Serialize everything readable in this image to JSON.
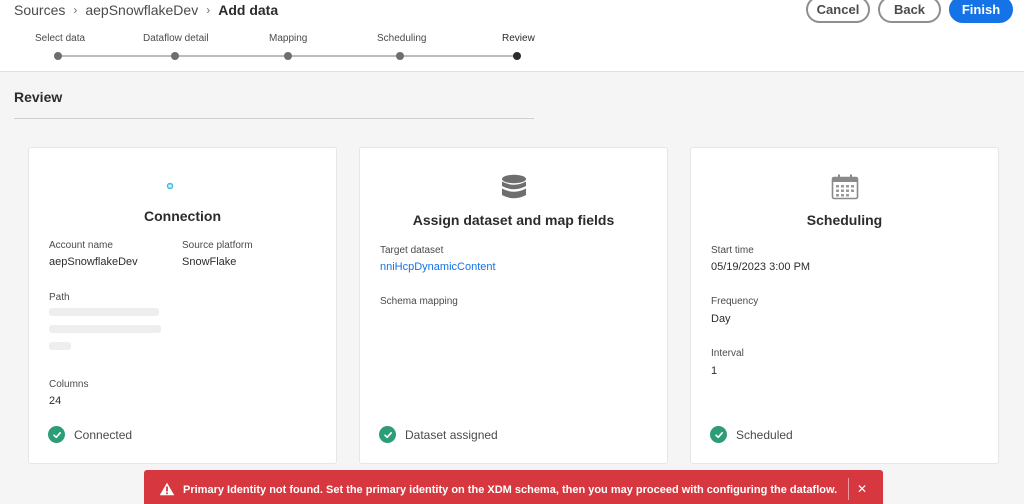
{
  "breadcrumb": {
    "items": [
      "Sources",
      "aepSnowflakeDev"
    ],
    "current": "Add data"
  },
  "actions": {
    "cancel_label": "Cancel",
    "back_label": "Back",
    "finish_label": "Finish"
  },
  "stepper": {
    "steps": [
      {
        "label": "Select data"
      },
      {
        "label": "Dataflow detail"
      },
      {
        "label": "Mapping"
      },
      {
        "label": "Scheduling"
      },
      {
        "label": "Review"
      }
    ],
    "active_index": 4
  },
  "review": {
    "title": "Review"
  },
  "cards": {
    "connection": {
      "logo_text": "snowflake",
      "title": "Connection",
      "account_name_label": "Account name",
      "account_name_value": "aepSnowflakeDev",
      "source_platform_label": "Source platform",
      "source_platform_value": "SnowFlake",
      "path_label": "Path",
      "columns_label": "Columns",
      "columns_value": "24",
      "status_text": "Connected"
    },
    "dataset": {
      "icon": "database-icon",
      "title": "Assign dataset and map fields",
      "target_dataset_label": "Target dataset",
      "target_dataset_value": "nniHcpDynamicContent",
      "schema_mapping_label": "Schema mapping",
      "status_text": "Dataset assigned"
    },
    "scheduling": {
      "icon": "calendar-icon",
      "title": "Scheduling",
      "start_time_label": "Start time",
      "start_time_value": "05/19/2023 3:00 PM",
      "frequency_label": "Frequency",
      "frequency_value": "Day",
      "interval_label": "Interval",
      "interval_value": "1",
      "status_text": "Scheduled"
    }
  },
  "toast": {
    "message": "Primary Identity not found. Set the primary identity on the XDM schema, then you may proceed with configuring the dataflow.",
    "close_glyph": "✕"
  },
  "colors": {
    "accent": "#1473e6",
    "success": "#2d9d78",
    "error": "#d7373f"
  }
}
